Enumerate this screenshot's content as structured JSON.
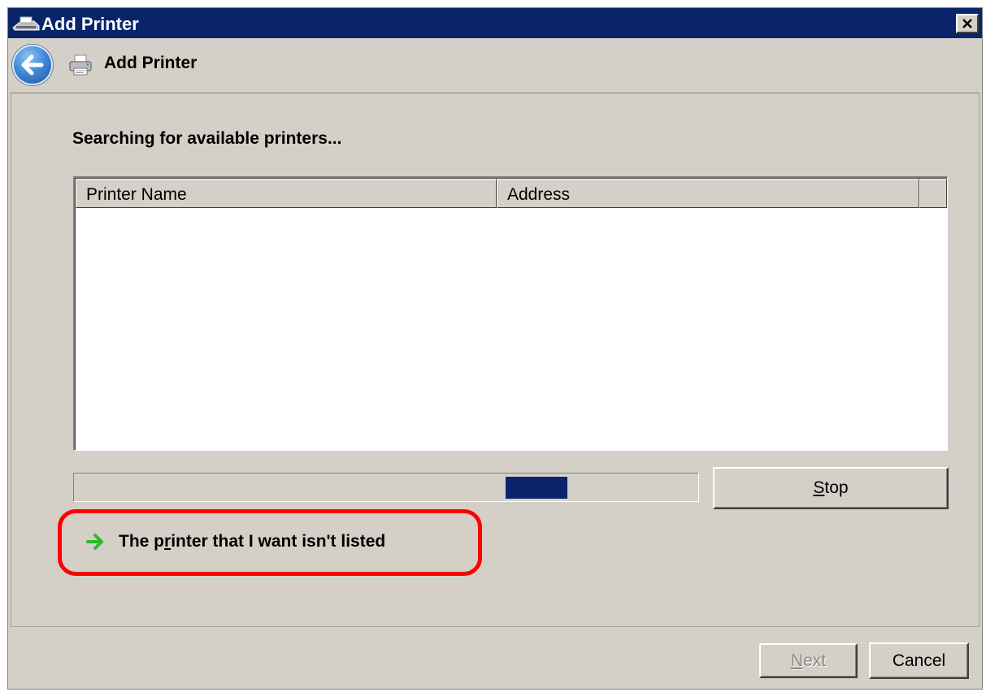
{
  "window": {
    "title": "Add Printer",
    "icon": "printer-add-icon",
    "close_icon": "close-icon"
  },
  "nav": {
    "back_icon": "back-arrow-icon",
    "printer_icon": "printer-icon",
    "title": "Add Printer"
  },
  "content": {
    "heading": "Searching for available printers...",
    "list": {
      "columns": [
        "Printer Name",
        "Address"
      ],
      "rows": []
    },
    "progress": {
      "state": "indeterminate (marquee)"
    },
    "stop_button": {
      "accel": "S",
      "rest": "top"
    },
    "link": {
      "icon": "green-arrow-icon",
      "before": "The p",
      "accel": "r",
      "after": "inter that I want isn't listed"
    }
  },
  "footer": {
    "next_button": {
      "accel": "N",
      "rest": "ext",
      "enabled": false
    },
    "cancel_button": {
      "label": "Cancel"
    }
  },
  "colors": {
    "titlebar": "#0a246a",
    "window_face": "#d4d0c8",
    "highlight_ring": "#ff0000",
    "link_arrow": "#2fb82f"
  }
}
